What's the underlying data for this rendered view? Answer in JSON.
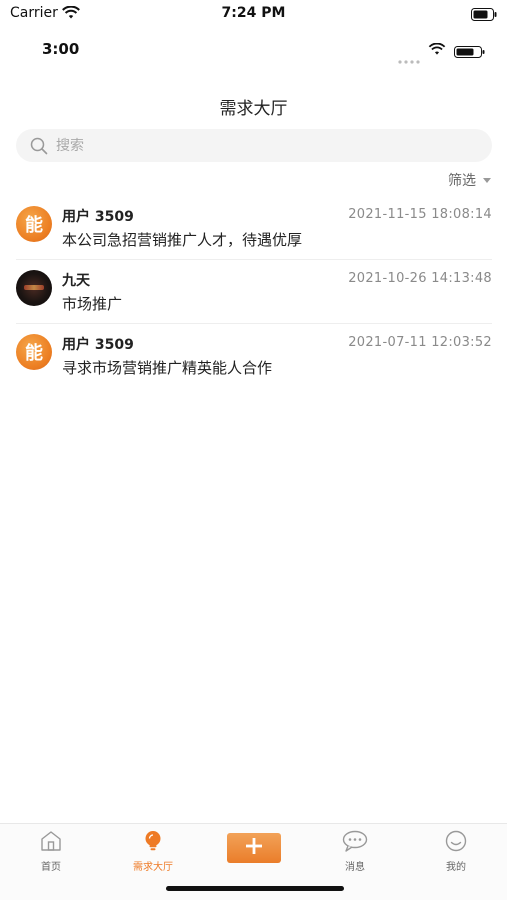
{
  "system_status": {
    "carrier": "Carrier",
    "time": "7:24 PM"
  },
  "app_status": {
    "time": "3:00"
  },
  "nav": {
    "title": "需求大厅"
  },
  "search": {
    "placeholder": "搜索",
    "value": ""
  },
  "filter": {
    "label": "筛选"
  },
  "list": {
    "items": [
      {
        "user": "用户 3509",
        "time": "2021-11-15 18:08:14",
        "content": "本公司急招营销推广人才，待遇优厚",
        "avatar": "orange-badge-avatar",
        "avatar_glyph": "能"
      },
      {
        "user": "九天",
        "time": "2021-10-26 14:13:48",
        "content": "市场推广",
        "avatar": "photo-avatar"
      },
      {
        "user": "用户 3509",
        "time": "2021-07-11 12:03:52",
        "content": "寻求市场营销推广精英能人合作",
        "avatar": "orange-badge-avatar",
        "avatar_glyph": "能"
      }
    ]
  },
  "tabbar": {
    "home": "首页",
    "demand": "需求大厅",
    "messages": "消息",
    "mine": "我的",
    "publish_symbol": "+"
  },
  "colors": {
    "accent": "#ee7a25",
    "text": "#222222",
    "muted": "#8a8a8a"
  }
}
